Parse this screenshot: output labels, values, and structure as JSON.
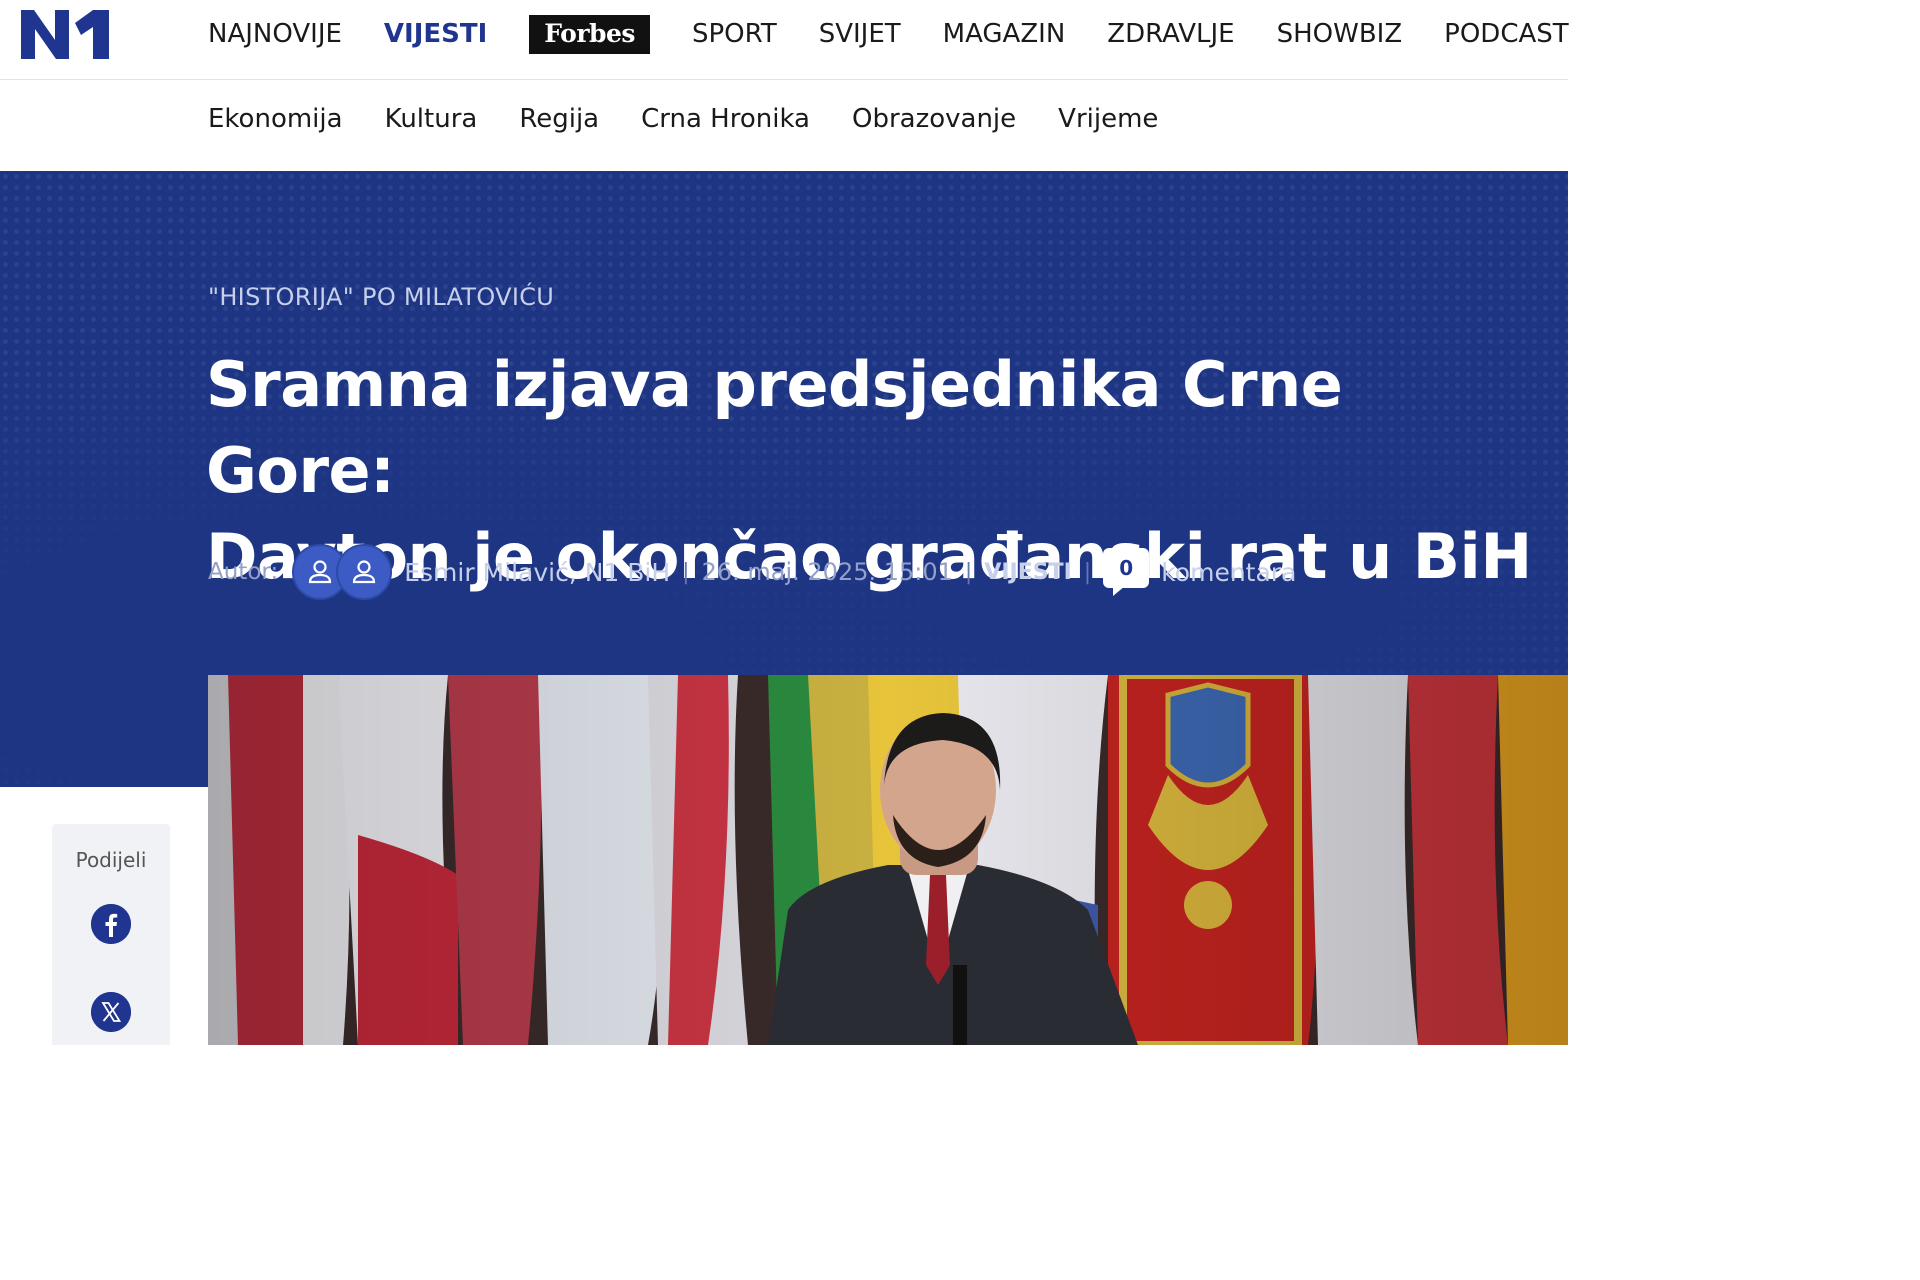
{
  "brand": {
    "logo_text": "N1",
    "accent": "#1f3590",
    "hero_bg": "#1e3584"
  },
  "nav": {
    "items": [
      {
        "label": "NAJNOVIJE"
      },
      {
        "label": "VIJESTI"
      },
      {
        "label": "Forbes"
      },
      {
        "label": "SPORT"
      },
      {
        "label": "SVIJET"
      },
      {
        "label": "MAGAZIN"
      },
      {
        "label": "ZDRAVLJE"
      },
      {
        "label": "SHOWBIZ"
      },
      {
        "label": "PODCAST"
      }
    ]
  },
  "subnav": {
    "items": [
      {
        "label": "Ekonomija"
      },
      {
        "label": "Kultura"
      },
      {
        "label": "Regija"
      },
      {
        "label": "Crna Hronika"
      },
      {
        "label": "Obrazovanje"
      },
      {
        "label": "Vrijeme"
      }
    ]
  },
  "article": {
    "kicker": "\"HISTORIJA\" PO MILATOVIĆU",
    "title_line1": "Sramna izjava predsjednika Crne Gore:",
    "title_line2": "Dayton je okončao građanski rat u BiH",
    "author_label": "Autor:",
    "author": "Esmir Milavić, N1 BiH",
    "date": "26. maj. 2025. 15:01",
    "category": "VIJESTI",
    "comment_count": "0",
    "comment_label": "komentara"
  },
  "share": {
    "label": "Podijeli",
    "buttons": [
      {
        "icon": "facebook-icon"
      },
      {
        "icon": "x-twitter-icon"
      }
    ]
  }
}
